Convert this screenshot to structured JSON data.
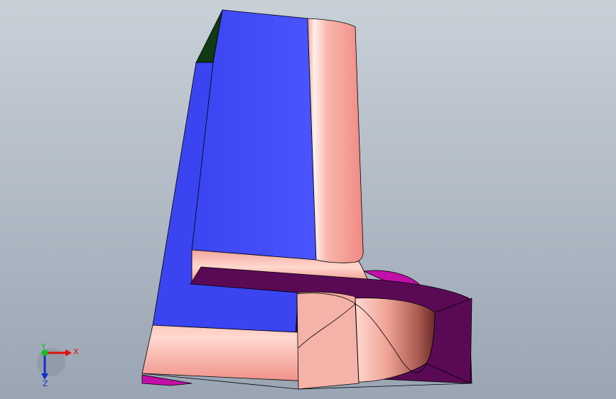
{
  "viewport": {
    "background_top": "#c8d0d8",
    "background_bottom": "#9aa5b3"
  },
  "model": {
    "colors": {
      "blue_face": "#3a44f0",
      "blue_face_light": "#4a55ff",
      "salmon": "#f39a93",
      "salmon_light": "#ffe7e2",
      "dark_purple": "#5a0a55",
      "magenta": "#c20fa8",
      "dark_green": "#0f3a12"
    }
  },
  "triad": {
    "x_label": "X",
    "y_label": "Y",
    "z_label": "Z",
    "x_color": "#e01010",
    "y_color": "#10c020",
    "z_color": "#1030d0"
  }
}
